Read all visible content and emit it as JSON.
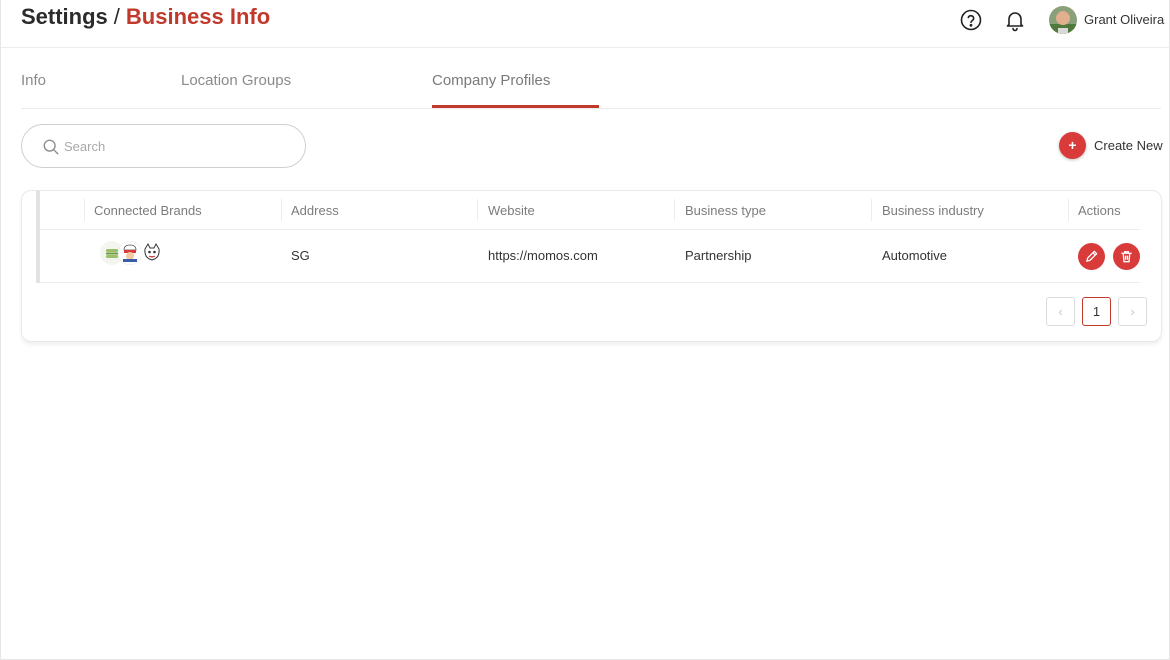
{
  "header": {
    "breadcrumb_root": "Settings",
    "breadcrumb_separator": "/",
    "breadcrumb_current": "Business Info",
    "help_icon": "help-circle-icon",
    "notification_icon": "bell-icon",
    "user_name": "Grant Oliveira"
  },
  "tabs": [
    {
      "label": "Info",
      "active": false
    },
    {
      "label": "Location Groups",
      "active": false
    },
    {
      "label": "Company Profiles",
      "active": true
    }
  ],
  "search": {
    "placeholder": "Search",
    "value": ""
  },
  "create_button": {
    "icon": "+",
    "label": "Create New"
  },
  "table": {
    "columns": [
      "Connected Brands",
      "Address",
      "Website",
      "Business type",
      "Business industry",
      "Actions"
    ],
    "rows": [
      {
        "connected_brands": [
          "brand-logo-burger",
          "brand-logo-chef",
          "brand-logo-cat"
        ],
        "address": "SG",
        "website": "https://momos.com",
        "business_type": "Partnership",
        "business_industry": "Automotive",
        "actions": [
          "edit-icon",
          "trash-icon"
        ]
      }
    ]
  },
  "pagination": {
    "prev": "‹",
    "current_page": "1",
    "next": "›"
  },
  "colors": {
    "accent": "#c0392b",
    "button": "#d93b3b"
  }
}
